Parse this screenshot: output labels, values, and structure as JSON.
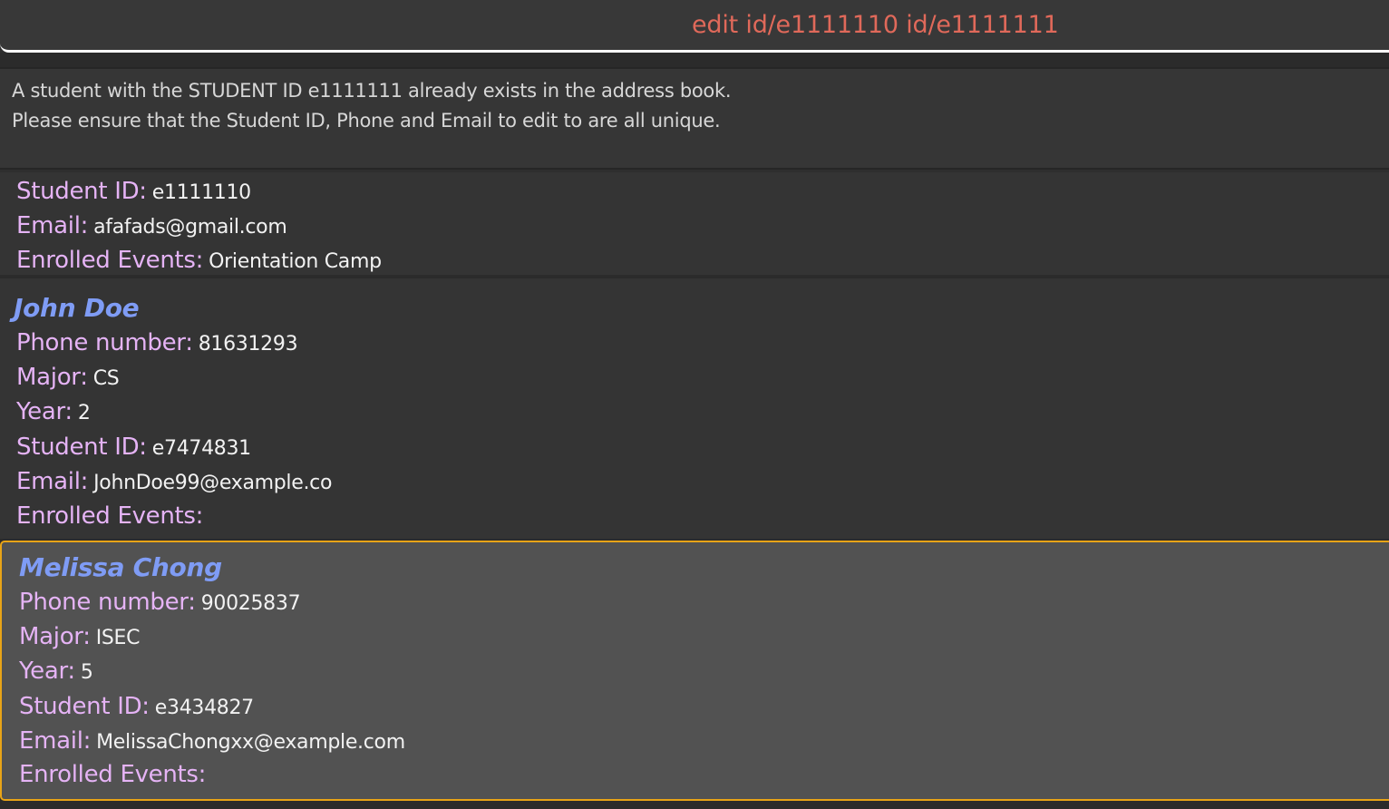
{
  "command_box": {
    "text": "edit id/e1111110 id/e1111111",
    "text_color": "#e0695a"
  },
  "result_display": {
    "line1": "A student with the STUDENT ID e1111111 already exists in the address book.",
    "line2": "Please ensure that the Student ID, Phone and Email to edit to are all unique."
  },
  "labels": {
    "phone": "Phone number:",
    "major": "Major:",
    "year": "Year:",
    "student_id": "Student ID:",
    "email": "Email:",
    "events": "Enrolled Events:"
  },
  "students": [
    {
      "name": "",
      "phone": "",
      "major": "",
      "year": "",
      "student_id": "e1111110",
      "email": "afafads@gmail.com",
      "events": "Orientation Camp"
    },
    {
      "name": "John Doe",
      "phone": "81631293",
      "major": "CS",
      "year": "2",
      "student_id": "e7474831",
      "email": "JohnDoe99@example.co",
      "events": ""
    },
    {
      "name": "Melissa Chong",
      "phone": "90025837",
      "major": "ISEC",
      "year": "5",
      "student_id": "e3434827",
      "email": "MelissaChongxx@example.com",
      "events": "",
      "selected": true
    }
  ],
  "colors": {
    "label": "#e5b3f5",
    "name": "#7f9cf5",
    "selected_border": "#e8a417"
  }
}
